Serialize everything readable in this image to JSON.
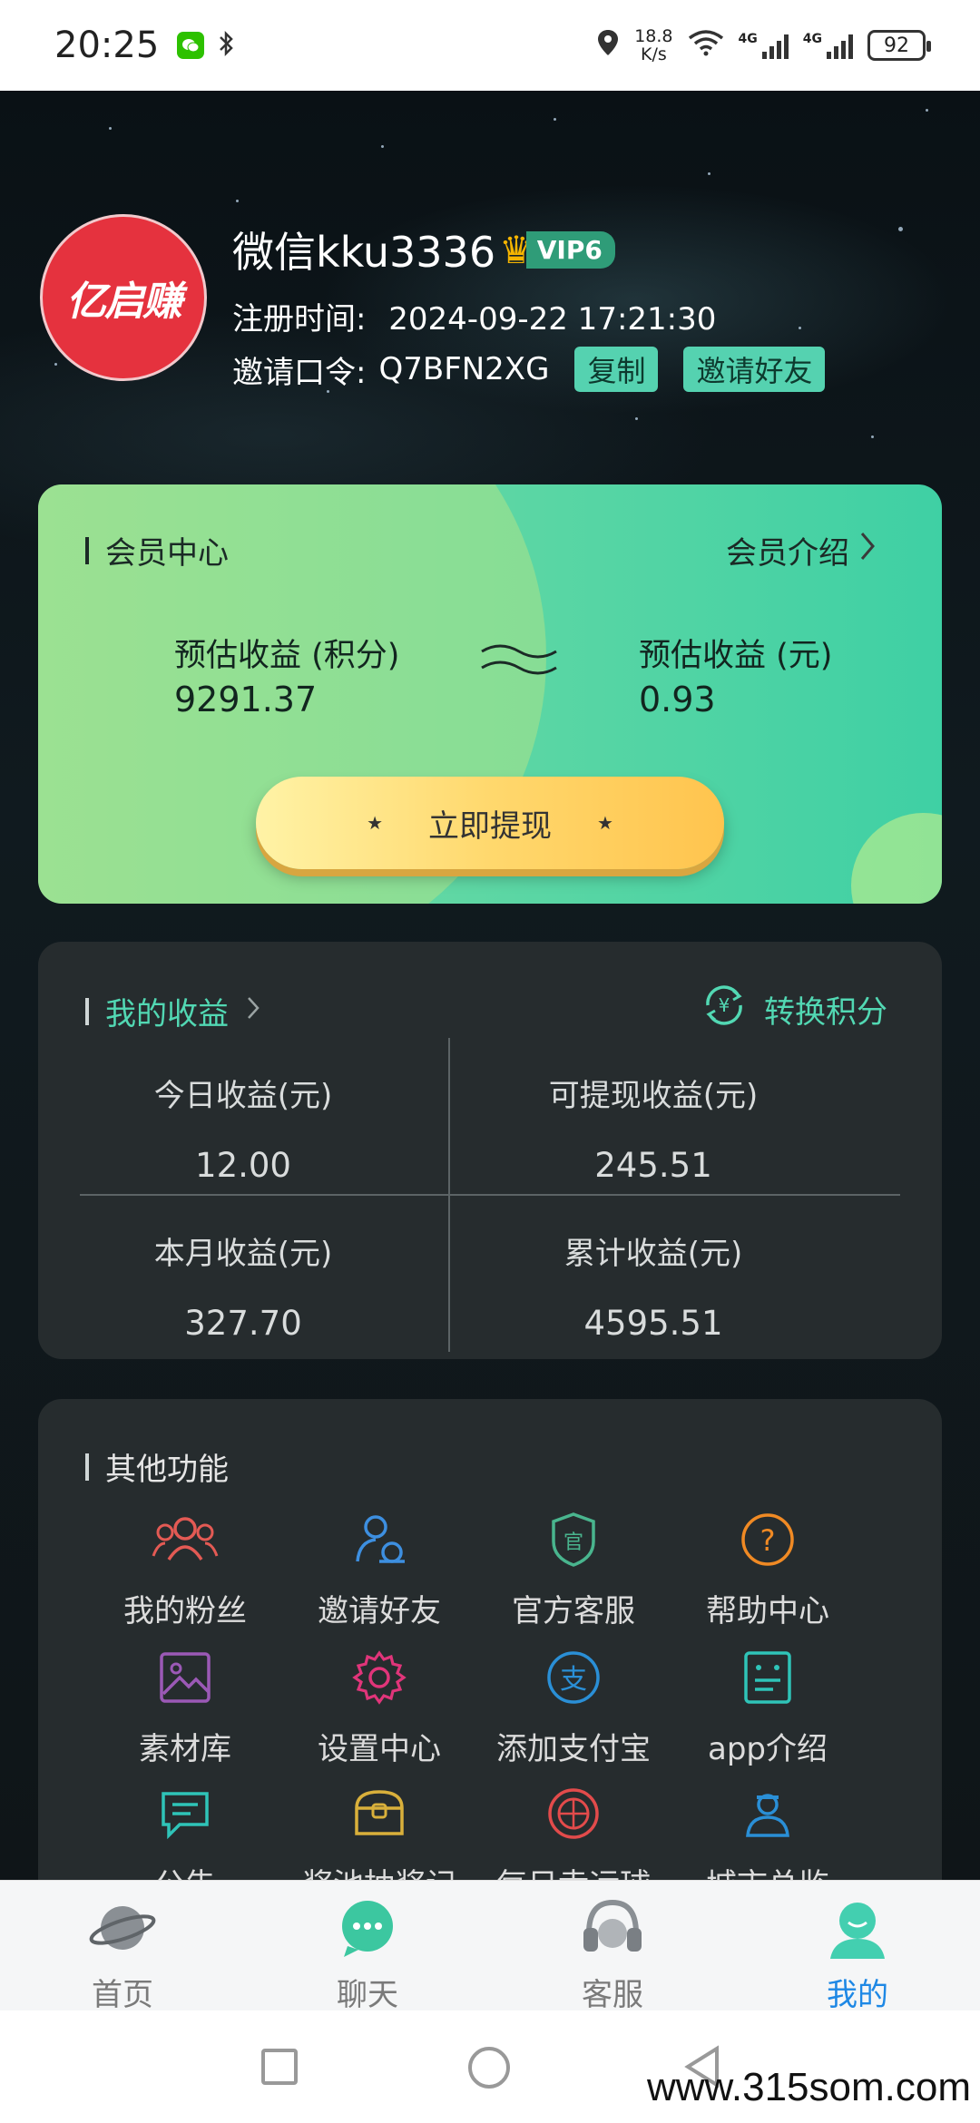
{
  "status_bar": {
    "time": "20:25",
    "speed_value": "18.8",
    "speed_unit": "K/s",
    "net1": "4G",
    "net2": "4G",
    "battery": "92"
  },
  "profile": {
    "avatar_text": "亿启赚",
    "username": "微信kku3336",
    "vip": "VIP6",
    "reg_label": "注册时间:",
    "reg_time": "2024-09-22 17:21:30",
    "invite_label": "邀请口令:",
    "invite_code": "Q7BFN2XG",
    "copy_label": "复制",
    "invite_friends_label": "邀请好友"
  },
  "member": {
    "title": "会员中心",
    "intro_label": "会员介绍",
    "left_label": "预估收益 (积分)",
    "left_value": "9291.37",
    "right_label": "预估收益 (元)",
    "right_value": "0.93",
    "withdraw_label": "立即提现",
    "star": "★"
  },
  "earnings": {
    "title": "我的收益",
    "convert_label": "转换积分",
    "today_label": "今日收益(元)",
    "today_value": "12.00",
    "withdrawable_label": "可提现收益(元)",
    "withdrawable_value": "245.51",
    "month_label": "本月收益(元)",
    "month_value": "327.70",
    "total_label": "累计收益(元)",
    "total_value": "4595.51"
  },
  "functions": {
    "title": "其他功能",
    "items": [
      {
        "label": "我的粉丝"
      },
      {
        "label": "邀请好友"
      },
      {
        "label": "官方客服"
      },
      {
        "label": "帮助中心"
      },
      {
        "label": "素材库"
      },
      {
        "label": "设置中心"
      },
      {
        "label": "添加支付宝"
      },
      {
        "label": "app介绍"
      },
      {
        "label": "公告"
      },
      {
        "label": "奖池抽奖记"
      },
      {
        "label": "每日幸运球"
      },
      {
        "label": "城市总监"
      }
    ]
  },
  "nav": {
    "items": [
      {
        "label": "首页"
      },
      {
        "label": "聊天"
      },
      {
        "label": "客服"
      },
      {
        "label": "我的"
      }
    ]
  },
  "watermark": "www.315som.com",
  "colors": {
    "accent_green": "#52d8b3",
    "nav_active": "#1e88e5",
    "card_bg": "#262c2e"
  }
}
